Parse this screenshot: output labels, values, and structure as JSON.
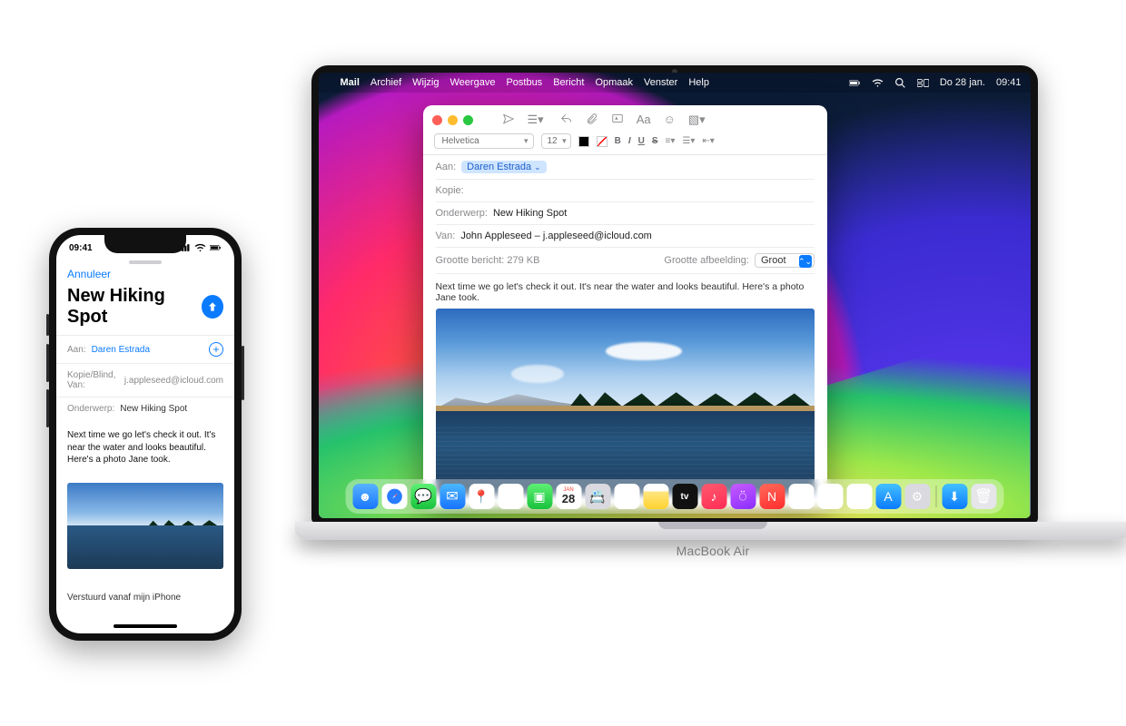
{
  "mac": {
    "menubar": {
      "items": [
        "Mail",
        "Archief",
        "Wijzig",
        "Weergave",
        "Postbus",
        "Bericht",
        "Opmaak",
        "Venster",
        "Help"
      ],
      "date": "Do 28 jan.",
      "time": "09:41"
    },
    "mail": {
      "font": "Helvetica",
      "size": "12",
      "to_label": "Aan:",
      "to_value": "Daren Estrada",
      "cc_label": "Kopie:",
      "subject_label": "Onderwerp:",
      "subject_value": "New Hiking Spot",
      "from_label": "Van:",
      "from_value": "John Appleseed – j.appleseed@icloud.com",
      "size_label": "Grootte bericht:",
      "size_value": "279 KB",
      "imgsize_label": "Grootte afbeelding:",
      "imgsize_value": "Groot",
      "body": "Next time we go let's check it out. It's near the water and looks beautiful. Here's a photo Jane took.",
      "fmt": {
        "b": "B",
        "i": "I",
        "u": "U",
        "s": "S"
      }
    },
    "dock": {
      "cal_month": "JAN",
      "cal_day": "28",
      "tv": "tv"
    },
    "label": "MacBook Air"
  },
  "iphone": {
    "time": "09:41",
    "cancel": "Annuleer",
    "title": "New Hiking Spot",
    "to_label": "Aan:",
    "to_value": "Daren Estrada",
    "ccfrom_label": "Kopie/Blind, Van:",
    "ccfrom_value": "j.appleseed@icloud.com",
    "subject_label": "Onderwerp:",
    "subject_value": "New Hiking Spot",
    "body": "Next time we go let's check it out. It's near the water and looks beautiful. Here's a photo Jane took.",
    "signature": "Verstuurd vanaf mijn iPhone"
  }
}
